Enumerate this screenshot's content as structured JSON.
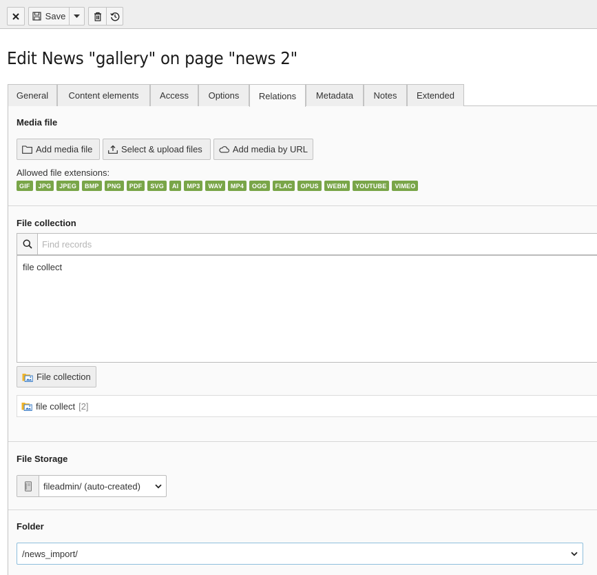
{
  "toolbar": {
    "close_icon": "close-icon",
    "save_label": "Save",
    "save_icon": "save-icon",
    "dropdown_icon": "caret-down-icon",
    "delete_icon": "trash-icon",
    "history_icon": "history-icon"
  },
  "page": {
    "title": "Edit News \"gallery\" on page \"news 2\""
  },
  "tabs": [
    {
      "label": "General"
    },
    {
      "label": "Content elements"
    },
    {
      "label": "Access"
    },
    {
      "label": "Options"
    },
    {
      "label": "Relations",
      "active": true
    },
    {
      "label": "Metadata"
    },
    {
      "label": "Notes"
    },
    {
      "label": "Extended"
    }
  ],
  "media": {
    "title": "Media file",
    "add_media_label": "Add media file",
    "select_upload_label": "Select & upload files",
    "add_by_url_label": "Add media by URL",
    "allowed_label": "Allowed file extensions:",
    "extensions": [
      "GIF",
      "JPG",
      "JPEG",
      "BMP",
      "PNG",
      "PDF",
      "SVG",
      "AI",
      "MP3",
      "WAV",
      "MP4",
      "OGG",
      "FLAC",
      "OPUS",
      "WEBM",
      "YOUTUBE",
      "VIMEO"
    ]
  },
  "file_collection": {
    "title": "File collection",
    "search_placeholder": "Find records",
    "search_value": "",
    "results": [
      "file collect"
    ],
    "button_label": "File collection",
    "record_title": "file collect",
    "record_uid": "[2]"
  },
  "file_storage": {
    "title": "File Storage",
    "selected": "fileadmin/ (auto-created)"
  },
  "folder": {
    "title": "Folder",
    "selected": "/news_import/"
  },
  "colors": {
    "badge_green": "#79a548",
    "toolbar_bg": "#eeeeee",
    "panel_bg": "#fafafa",
    "focus_border": "#8dbedc"
  }
}
